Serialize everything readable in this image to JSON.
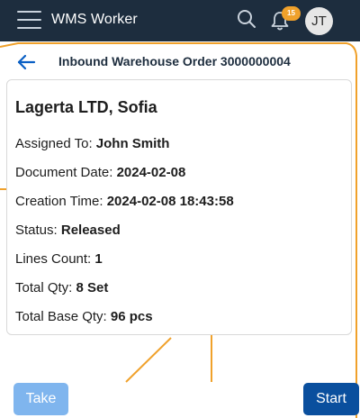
{
  "header": {
    "app_title": "WMS Worker",
    "notification_count": "15",
    "avatar_initials": "JT"
  },
  "subheader": {
    "title": "Inbound Warehouse Order 3000000004"
  },
  "order": {
    "customer": "Lagerta LTD, Sofia",
    "fields": [
      {
        "label": "Assigned To:",
        "value": "John Smith"
      },
      {
        "label": "Document Date:",
        "value": "2024-02-08"
      },
      {
        "label": "Creation Time:",
        "value": "2024-02-08 18:43:58"
      },
      {
        "label": "Status:",
        "value": "Released"
      },
      {
        "label": "Lines Count:",
        "value": "1"
      },
      {
        "label": "Total Qty:",
        "value": "8 Set"
      },
      {
        "label": "Total Base Qty:",
        "value": "96 pcs"
      }
    ]
  },
  "actions": {
    "take_label": "Take",
    "start_label": "Start"
  },
  "colors": {
    "header_bg": "#1d2d3e",
    "accent_orange": "#f0a12b",
    "primary_button": "#0a4f9e",
    "disabled_button": "#7fb5ee"
  },
  "icons": [
    "hamburger-menu-icon",
    "search-icon",
    "bell-icon",
    "back-arrow-icon"
  ]
}
